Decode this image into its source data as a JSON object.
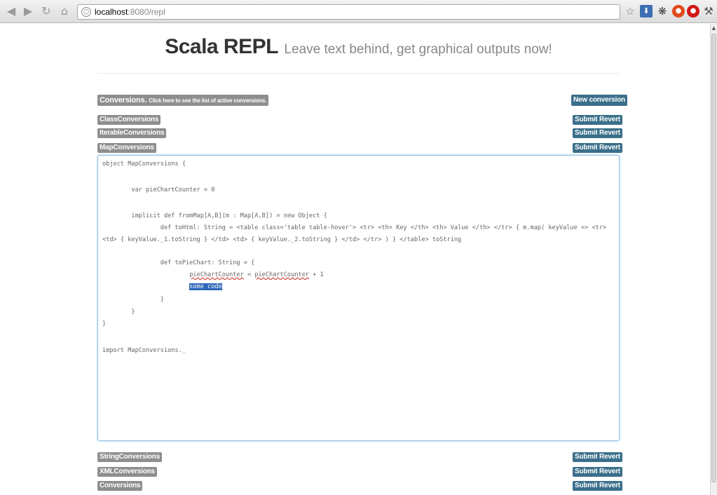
{
  "browser": {
    "url_host": "localhost",
    "url_rest": ":8080/repl"
  },
  "page": {
    "title": "Scala REPL",
    "subtitle": "Leave text behind, get graphical outputs now!"
  },
  "conversions_header": {
    "label": "Conversions.",
    "hint": "Click here to see the list of active conversions.",
    "new_button": "New conversion"
  },
  "buttons": {
    "submit": "Submit",
    "revert": "Revert"
  },
  "conversion_items_top": [
    "ClassConversions",
    "IterableConversions",
    "MapConversions"
  ],
  "conversion_items_bottom": [
    "StringConversions",
    "XMLConversions",
    "Conversions"
  ],
  "editor": {
    "lines": [
      "object MapConversions {",
      "        var pieChartCounter = 0",
      "        implicit def fromMap[A,B](m : Map[A,B]) = new Object {",
      "                def toHtml: String = <table class='table table-hover'> <tr> <th> Key </th> <th> Value </th> </tr> { m.map( keyValue => <tr>",
      "<td> { keyValue._1.toString } </td> <td> { keyValue._2.toString } </td> </tr> ) } </table> toString",
      "                def toPieChart: String = {",
      "                        ",
      " = ",
      " + 1",
      "                        ",
      "                }",
      "        }",
      "}",
      "import MapConversions._"
    ],
    "counter_word": "pieChartCounter",
    "selected_text": "some code"
  }
}
